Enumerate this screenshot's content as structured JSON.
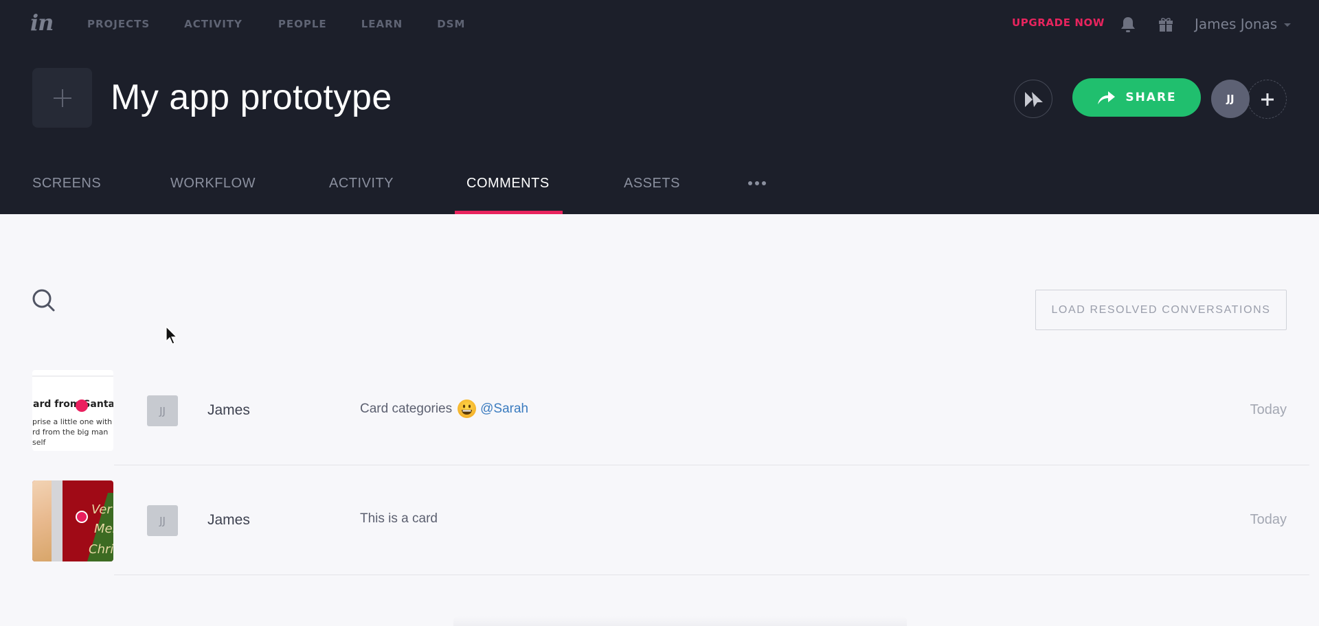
{
  "app": {
    "logo": "in",
    "nav": [
      "PROJECTS",
      "ACTIVITY",
      "PEOPLE",
      "LEARN",
      "DSM"
    ],
    "upgrade_label": "UPGRADE NOW",
    "user_name": "James Jonas",
    "icons": [
      "bell-icon",
      "gift-icon",
      "caret-down-icon"
    ]
  },
  "project": {
    "title": "My app prototype",
    "share_label": "SHARE",
    "collaborator_initials": "JJ"
  },
  "tabs": [
    {
      "label": "SCREENS",
      "active": false
    },
    {
      "label": "WORKFLOW",
      "active": false
    },
    {
      "label": "ACTIVITY",
      "active": false
    },
    {
      "label": "COMMENTS",
      "active": true
    },
    {
      "label": "ASSETS",
      "active": false
    }
  ],
  "comments": {
    "load_resolved_label": "LOAD RESOLVED CONVERSATIONS",
    "rows": [
      {
        "thumb_text": [
          "ard from Santa",
          "prise a little one with",
          "rd from the big man",
          "self"
        ],
        "avatar": "JJ",
        "author": "James",
        "text": "Card categories",
        "emoji": "grinning-face",
        "mention": "@Sarah",
        "date": "Today"
      },
      {
        "avatar": "JJ",
        "author": "James",
        "text": "This is a card",
        "date": "Today"
      }
    ]
  },
  "colors": {
    "header_bg": "#1c1f2a",
    "accent_pink": "#e8245e",
    "share_green": "#20bf6e",
    "mention_blue": "#3a7bbf",
    "page_bg": "#f7f7fa"
  }
}
